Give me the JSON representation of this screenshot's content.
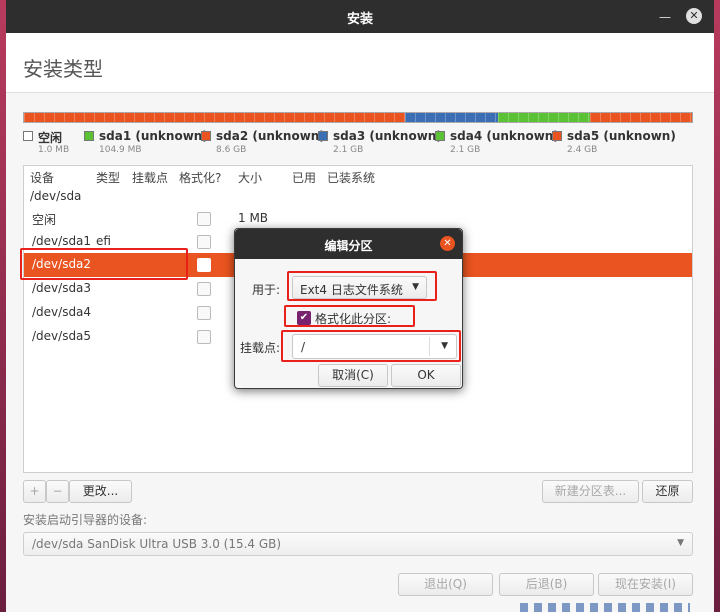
{
  "window": {
    "title": "安装"
  },
  "header": {
    "title": "安装类型"
  },
  "partition_bar": [
    {
      "color": "#e95420",
      "fraction": 0.57
    },
    {
      "color": "#3b6eb5",
      "fraction": 0.139
    },
    {
      "color": "#5bc236",
      "fraction": 0.139
    },
    {
      "color": "#e95420",
      "fraction": 0.152
    }
  ],
  "legend": [
    {
      "name": "空闲",
      "size": "1.0 MB",
      "color": "#ffffff"
    },
    {
      "name": "sda1 (unknown)",
      "size": "104.9 MB",
      "color": "#5bc236"
    },
    {
      "name": "sda2 (unknown)",
      "size": "8.6 GB",
      "color": "#e95420"
    },
    {
      "name": "sda3 (unknown)",
      "size": "2.1 GB",
      "color": "#3b6eb5"
    },
    {
      "name": "sda4 (unknown)",
      "size": "2.1 GB",
      "color": "#5bc236"
    },
    {
      "name": "sda5 (unknown)",
      "size": "2.4 GB",
      "color": "#e95420"
    }
  ],
  "table": {
    "columns": [
      "设备",
      "类型",
      "挂载点",
      "格式化?",
      "大小",
      "已用",
      "已装系统"
    ],
    "rows": [
      {
        "device": "/dev/sda",
        "type": "",
        "size": ""
      },
      {
        "device": "空闲",
        "type": "",
        "size": "1 MB"
      },
      {
        "device": "/dev/sda1",
        "type": "efi",
        "size": ""
      },
      {
        "device": "/dev/sda2",
        "type": "",
        "size": ""
      },
      {
        "device": "/dev/sda3",
        "type": "",
        "size": ""
      },
      {
        "device": "/dev/sda4",
        "type": "",
        "size": ""
      },
      {
        "device": "/dev/sda5",
        "type": "",
        "size": ""
      }
    ]
  },
  "toolbar": {
    "add": "+",
    "remove": "−",
    "change": "更改...",
    "new_table": "新建分区表...",
    "revert": "还原"
  },
  "bootloader": {
    "label": "安装启动引导器的设备:",
    "value": "/dev/sda SanDisk Ultra USB 3.0 (15.4 GB)"
  },
  "footer": {
    "quit": "退出(Q)",
    "back": "后退(B)",
    "install": "现在安装(I)"
  },
  "dialog": {
    "title": "编辑分区",
    "use_as_label": "用于:",
    "use_as_value": "Ext4 日志文件系统",
    "format_label": "格式化此分区:",
    "mount_label": "挂载点:",
    "mount_value": "/",
    "cancel": "取消(C)",
    "ok": "OK"
  },
  "icons": {
    "close": "close-icon",
    "dropdown": "chevron-down-icon",
    "check": "check-icon"
  }
}
